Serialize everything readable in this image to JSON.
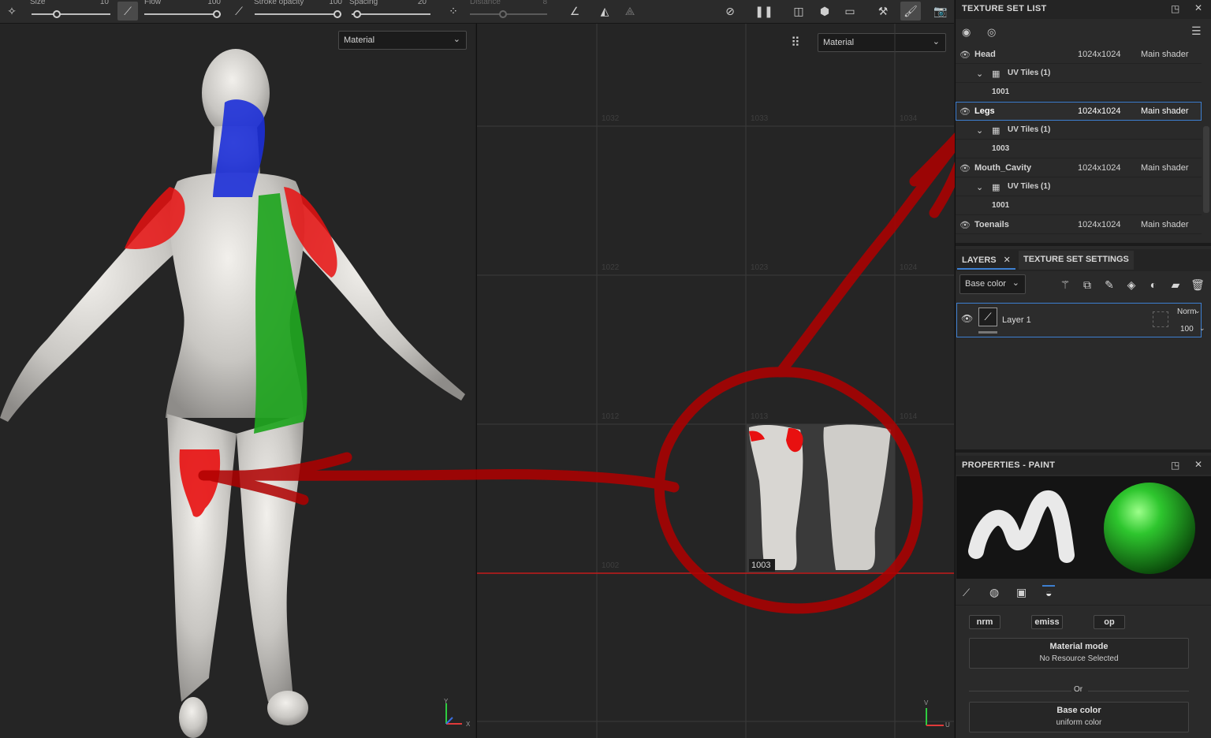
{
  "toolbar": {
    "size_label": "Size",
    "size_value": "10",
    "flow_label": "Flow",
    "flow_value": "100",
    "opacity_label": "Stroke opacity",
    "opacity_value": "100",
    "spacing_label": "Spacing",
    "spacing_value": "20",
    "distance_label": "Distance",
    "distance_value": "8",
    "icons": [
      "brush-preset-icon",
      "alignment-icon",
      "pressure-icon",
      "lazy-mouse-icon",
      "symmetry-icon",
      "mirror-icon",
      "hide-icon",
      "pause-icon",
      "camera-split-icon",
      "cube-icon",
      "video-icon",
      "projection-icon",
      "paint-brush-icon",
      "screenshot-icon"
    ]
  },
  "viewport3d": {
    "mode_select": "Material",
    "axes": [
      "Y",
      "X"
    ]
  },
  "viewport2d": {
    "mode_select": "Material",
    "udim_tiles": [
      "1032",
      "1033",
      "1034",
      "1022",
      "1023",
      "1024",
      "1012",
      "1013",
      "1014",
      "1002",
      "1003"
    ],
    "active_tile": "1003",
    "axes": [
      "V",
      "U"
    ]
  },
  "texture_set_list": {
    "title": "TEXTURE SET LIST",
    "sets": [
      {
        "name": "Head",
        "size": "1024x1024",
        "shader": "Main shader",
        "uv_tiles": "UV Tiles (1)",
        "tile": "1001",
        "selected": false
      },
      {
        "name": "Legs",
        "size": "1024x1024",
        "shader": "Main shader",
        "uv_tiles": "UV Tiles (1)",
        "tile": "1003",
        "selected": true
      },
      {
        "name": "Mouth_Cavity",
        "size": "1024x1024",
        "shader": "Main shader",
        "uv_tiles": "UV Tiles (1)",
        "tile": "1001",
        "selected": false
      },
      {
        "name": "Toenails",
        "size": "1024x1024",
        "shader": "Main shader",
        "selected": false
      }
    ]
  },
  "layers": {
    "tab_layers": "LAYERS",
    "tab_settings": "TEXTURE SET SETTINGS",
    "channel_select": "Base color",
    "items": [
      {
        "name": "Layer 1",
        "blend": "Norm",
        "opacity": "100"
      }
    ]
  },
  "properties": {
    "title": "PROPERTIES - PAINT",
    "channel_chips": [
      "nrm",
      "emiss",
      "op"
    ],
    "material_mode_title": "Material mode",
    "material_mode_value": "No Resource Selected",
    "or_label": "Or",
    "base_color_title": "Base color",
    "base_color_value": "uniform color"
  },
  "colors": {
    "annotation_red": "#b00000",
    "selection_blue": "#3d7fd1",
    "paint_red": "#e81010",
    "paint_green": "#1fa51f",
    "paint_blue": "#1c2fd8"
  }
}
